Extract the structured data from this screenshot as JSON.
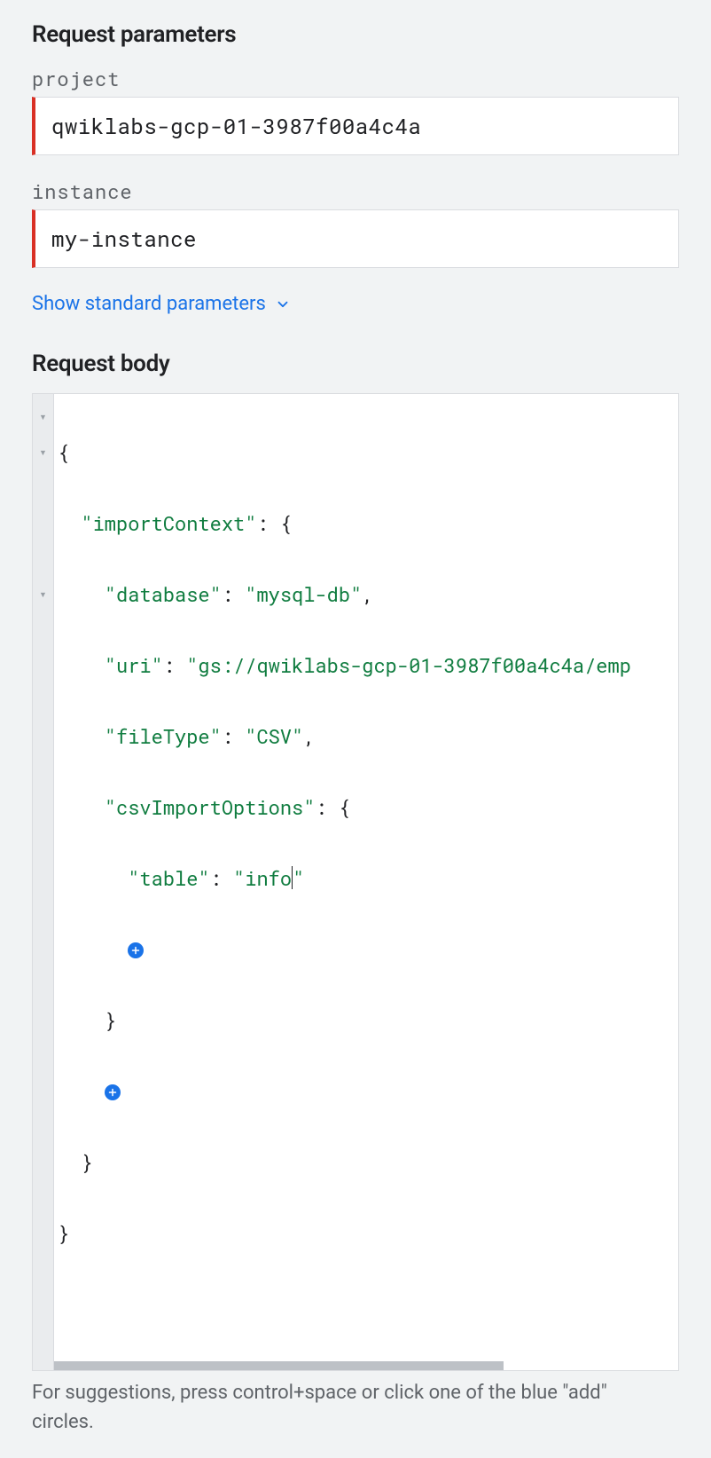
{
  "params": {
    "title": "Request parameters",
    "project_label": "project",
    "project_value": "qwiklabs-gcp-01-3987f00a4c4a",
    "instance_label": "instance",
    "instance_value": "my-instance",
    "show_standard": "Show standard parameters"
  },
  "body": {
    "title": "Request body",
    "json": {
      "importContext_key": "\"importContext\"",
      "database_key": "\"database\"",
      "database_val": "\"mysql-db\"",
      "uri_key": "\"uri\"",
      "uri_val": "\"gs://qwiklabs-gcp-01-3987f00a4c4a/emp",
      "fileType_key": "\"fileType\"",
      "fileType_val": "\"CSV\"",
      "csvOpts_key": "\"csvImportOptions\"",
      "table_key": "\"table\"",
      "table_val_open": "\"info",
      "table_val_close": "\""
    },
    "hint": "For suggestions, press control+space or click one of the blue \"add\" circles."
  }
}
